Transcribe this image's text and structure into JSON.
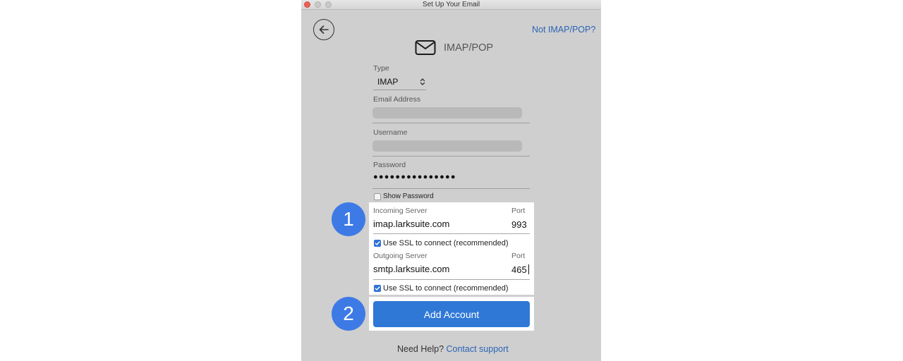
{
  "window": {
    "title": "Set Up Your Email"
  },
  "header": {
    "not_imap_link": "Not IMAP/POP?",
    "title": "IMAP/POP",
    "icons": {
      "back": "arrow-left-circle-icon",
      "mail": "envelope-icon"
    }
  },
  "form": {
    "type_label": "Type",
    "type_value": "IMAP",
    "email_label": "Email Address",
    "username_label": "Username",
    "password_label": "Password",
    "password_mask": "●●●●●●●●●●●●●●●",
    "show_password_label": "Show Password",
    "show_password_checked": false
  },
  "servers": {
    "incoming_label": "Incoming Server",
    "incoming_value": "imap.larksuite.com",
    "incoming_port_label": "Port",
    "incoming_port": "993",
    "incoming_ssl_label": "Use SSL to connect (recommended)",
    "incoming_ssl_checked": true,
    "outgoing_label": "Outgoing Server",
    "outgoing_value": "smtp.larksuite.com",
    "outgoing_port_label": "Port",
    "outgoing_port": "465",
    "outgoing_ssl_label": "Use SSL to connect (recommended)",
    "outgoing_ssl_checked": true
  },
  "actions": {
    "add_account_label": "Add Account"
  },
  "footer": {
    "help_text": "Need Help?",
    "contact_link": "Contact support"
  },
  "callouts": {
    "step1": "1",
    "step2": "2"
  },
  "colors": {
    "accent": "#2f78d6",
    "link": "#2a64b6",
    "badge": "#3d7ae5",
    "window_bg": "#cfcfcf"
  }
}
